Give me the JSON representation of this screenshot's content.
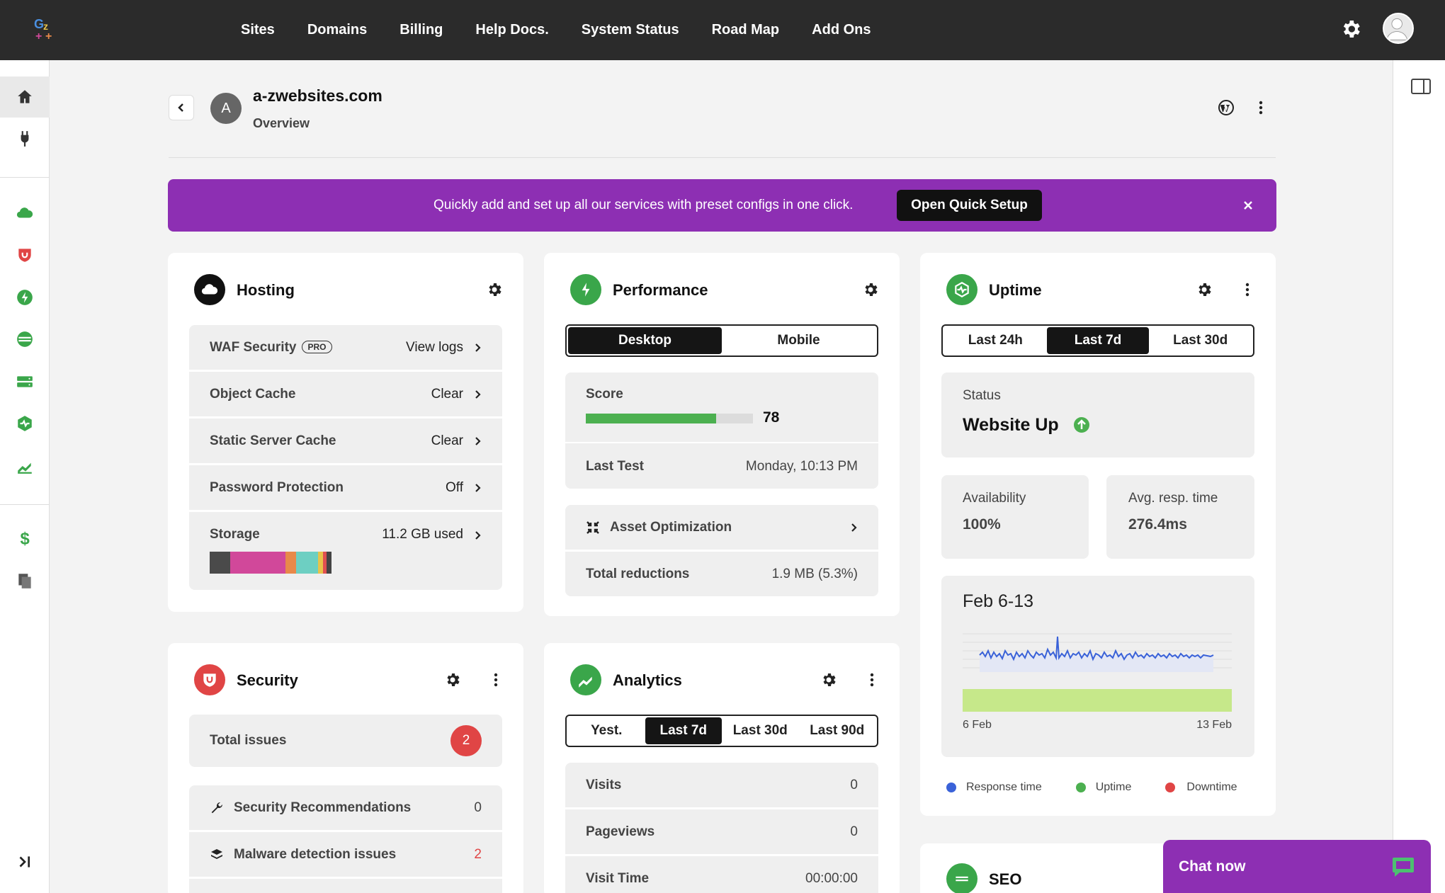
{
  "topnav": {
    "links": [
      "Sites",
      "Domains",
      "Billing",
      "Help Docs.",
      "System Status",
      "Road Map",
      "Add Ons"
    ]
  },
  "header": {
    "avatar_letter": "A",
    "site_name": "a-zwebsites.com",
    "subtitle": "Overview"
  },
  "banner": {
    "text": "Quickly add and set up all our services with preset configs in one click.",
    "button": "Open Quick Setup"
  },
  "hosting": {
    "title": "Hosting",
    "rows": [
      {
        "label": "WAF Security",
        "badge": "PRO",
        "value": "View logs"
      },
      {
        "label": "Object Cache",
        "value": "Clear"
      },
      {
        "label": "Static Server Cache",
        "value": "Clear"
      },
      {
        "label": "Password Protection",
        "value": "Off"
      },
      {
        "label": "Storage",
        "value": "11.2 GB used"
      }
    ],
    "storage_segments": [
      {
        "color": "#4a4a4a",
        "fraction": 0.17
      },
      {
        "color": "#d1489a",
        "fraction": 0.45
      },
      {
        "color": "#e8894a",
        "fraction": 0.09
      },
      {
        "color": "#6dcfc2",
        "fraction": 0.18
      },
      {
        "color": "#e8c34a",
        "fraction": 0.04
      },
      {
        "color": "#e05050",
        "fraction": 0.03
      },
      {
        "color": "#444444",
        "fraction": 0.04
      }
    ]
  },
  "performance": {
    "title": "Performance",
    "tabs": [
      "Desktop",
      "Mobile"
    ],
    "active_tab": 0,
    "score_label": "Score",
    "score": "78",
    "score_fraction": 0.78,
    "last_test_label": "Last Test",
    "last_test_value": "Monday, 10:13 PM",
    "asset_label": "Asset Optimization",
    "reductions_label": "Total reductions",
    "reductions_value": "1.9 MB (5.3%)"
  },
  "uptime": {
    "title": "Uptime",
    "tabs": [
      "Last 24h",
      "Last 7d",
      "Last 30d"
    ],
    "active_tab": 1,
    "status_label": "Status",
    "status_value": "Website Up",
    "availability_label": "Availability",
    "availability_value": "100%",
    "resp_label": "Avg. resp. time",
    "resp_value": "276.4ms",
    "range_title": "Feb 6-13",
    "axis_start": "6 Feb",
    "axis_end": "13 Feb",
    "legend": [
      {
        "label": "Response time",
        "color": "#3a62d8"
      },
      {
        "label": "Uptime",
        "color": "#4caf50"
      },
      {
        "label": "Downtime",
        "color": "#e04545"
      }
    ]
  },
  "security": {
    "title": "Security",
    "total_label": "Total issues",
    "total_value": "2",
    "rows": [
      {
        "label": "Security Recommendations",
        "value": "0"
      },
      {
        "label": "Malware detection issues",
        "value": "2"
      }
    ]
  },
  "analytics": {
    "title": "Analytics",
    "tabs": [
      "Yest.",
      "Last 7d",
      "Last 30d",
      "Last 90d"
    ],
    "active_tab": 1,
    "rows": [
      {
        "label": "Visits",
        "value": "0"
      },
      {
        "label": "Pageviews",
        "value": "0"
      },
      {
        "label": "Visit Time",
        "value": "00:00:00"
      }
    ]
  },
  "seo": {
    "title": "SEO"
  },
  "chat": {
    "label": "Chat now"
  }
}
